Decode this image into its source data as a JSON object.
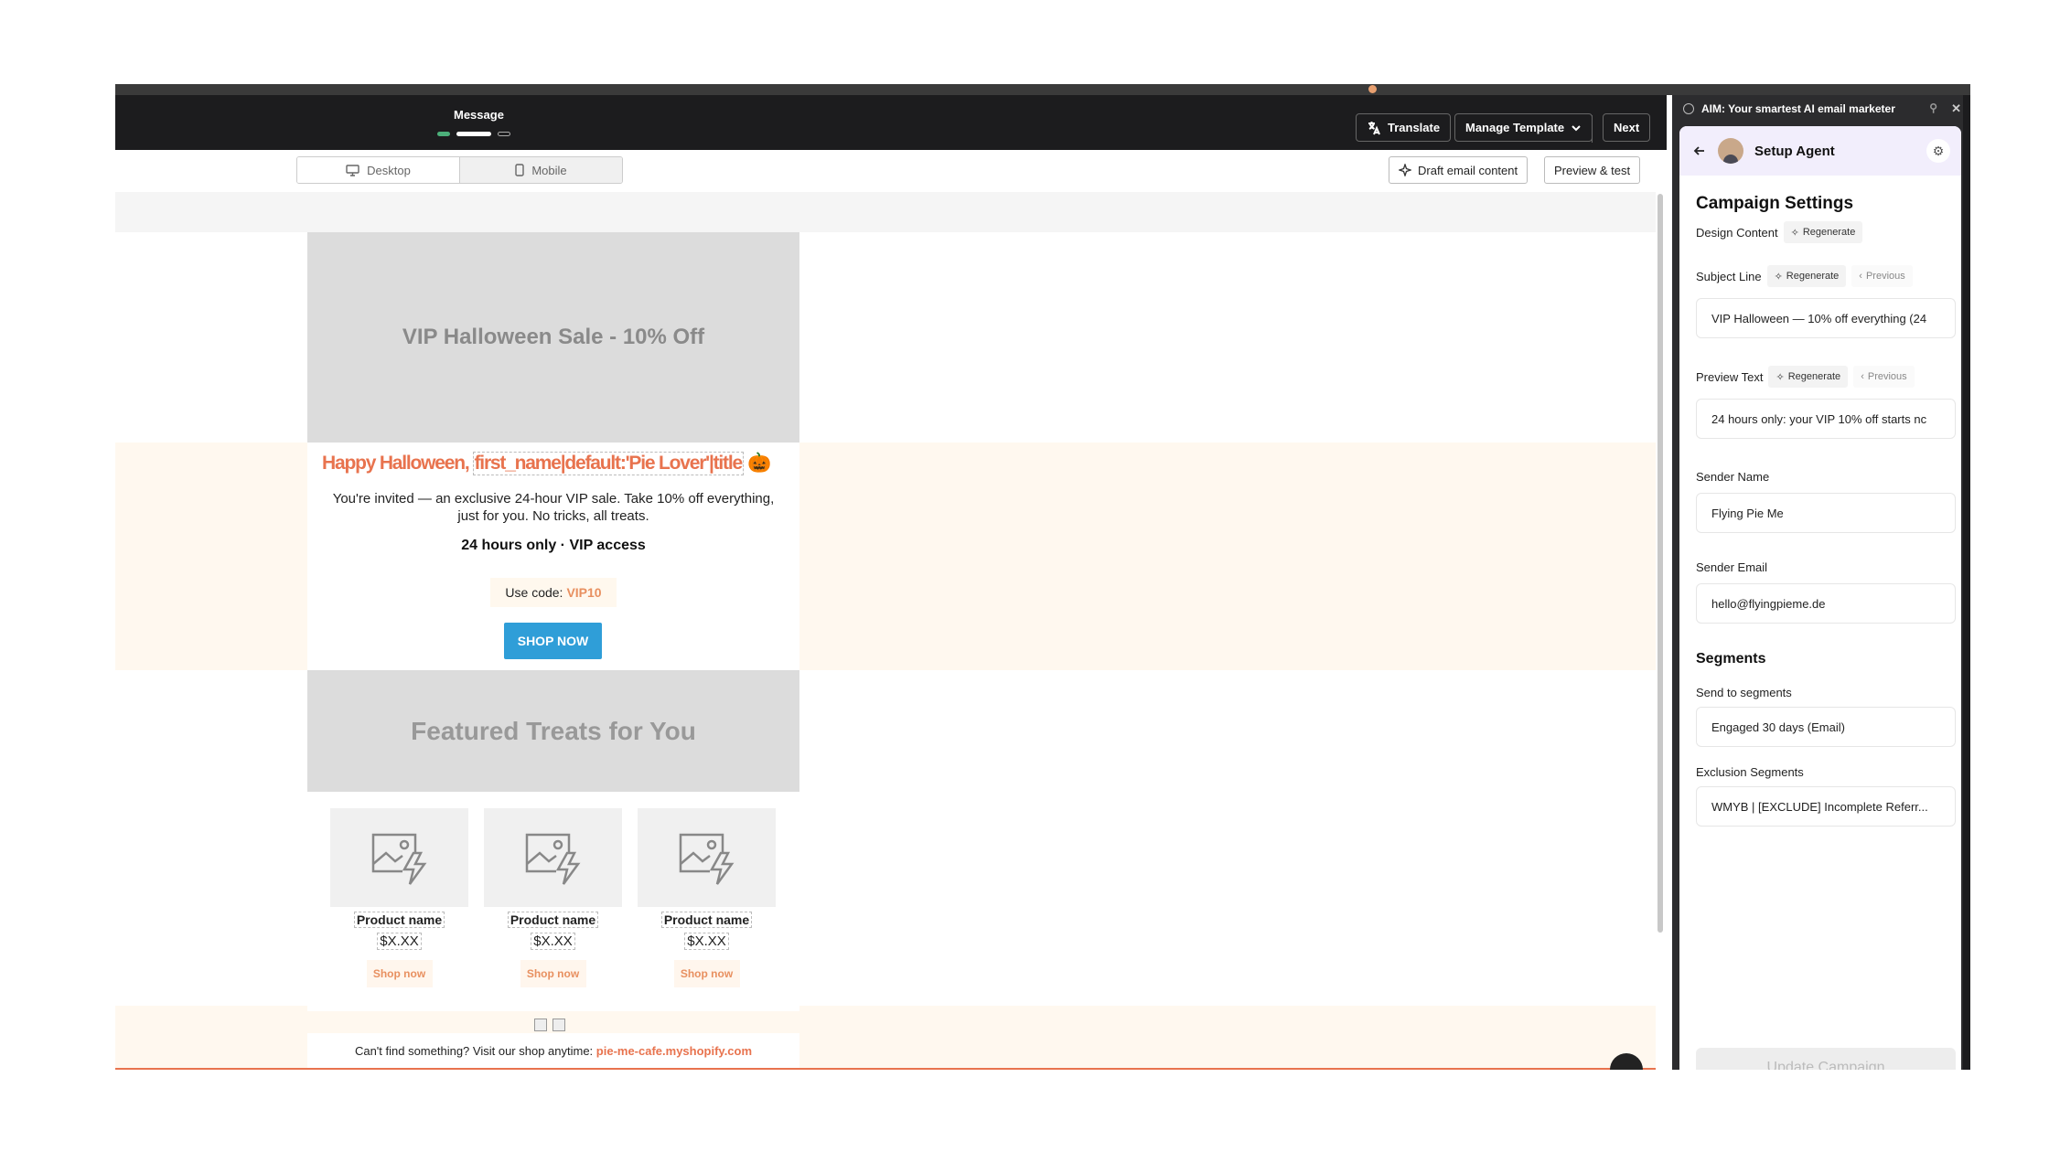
{
  "editor": {
    "tab_title": "Message",
    "translate_label": "Translate",
    "manage_template_label": "Manage Template",
    "next_label": "Next",
    "desktop_label": "Desktop",
    "mobile_label": "Mobile",
    "draft_label": "Draft email content",
    "preview_label": "Preview & test"
  },
  "email": {
    "hero_title": "VIP Halloween Sale - 10% Off",
    "greeting_prefix": "Happy Halloween, ",
    "greeting_var": "first_name|default:'Pie Lover'|title",
    "greeting_emoji": "🎃",
    "invite_text": "You're invited — an exclusive 24-hour VIP sale. Take 10% off everything, just for you. No tricks, all treats.",
    "hours_text": "24 hours only · VIP access",
    "code_prefix": "Use code:",
    "code_value": "VIP10",
    "shop_now": "SHOP NOW",
    "featured_title": "Featured Treats for You",
    "products": [
      {
        "name": "Product name",
        "price": "$X.XX",
        "cta": "Shop now"
      },
      {
        "name": "Product name",
        "price": "$X.XX",
        "cta": "Shop now"
      },
      {
        "name": "Product name",
        "price": "$X.XX",
        "cta": "Shop now"
      }
    ],
    "footer_prefix": "Can't find something? Visit our shop anytime: ",
    "footer_link": "pie-me-cafe.myshopify.com"
  },
  "ai": {
    "header": "AIM: Your smartest AI email marketer",
    "nav_title": "Setup Agent",
    "heading": "Campaign Settings",
    "design_content_label": "Design Content",
    "regenerate_label": "Regenerate",
    "previous_label": "Previous",
    "subject_label": "Subject Line",
    "subject_value": "VIP Halloween — 10% off everything (24",
    "preview_text_label": "Preview Text",
    "preview_text_value": "24 hours only: your VIP 10% off starts nc",
    "sender_name_label": "Sender Name",
    "sender_name_value": "Flying Pie Me",
    "sender_email_label": "Sender Email",
    "sender_email_value": "hello@flyingpieme.de",
    "segments_heading": "Segments",
    "send_to_label": "Send to segments",
    "send_to_value": "Engaged 30 days (Email)",
    "exclusion_label": "Exclusion Segments",
    "exclusion_value": "WMYB | [EXCLUDE] Incomplete Referr...",
    "update_label": "Update Campaign"
  },
  "colors": {
    "accent_orange": "#e8734e",
    "button_blue": "#2f9ed8",
    "panel_dark": "#2c2c2e"
  }
}
